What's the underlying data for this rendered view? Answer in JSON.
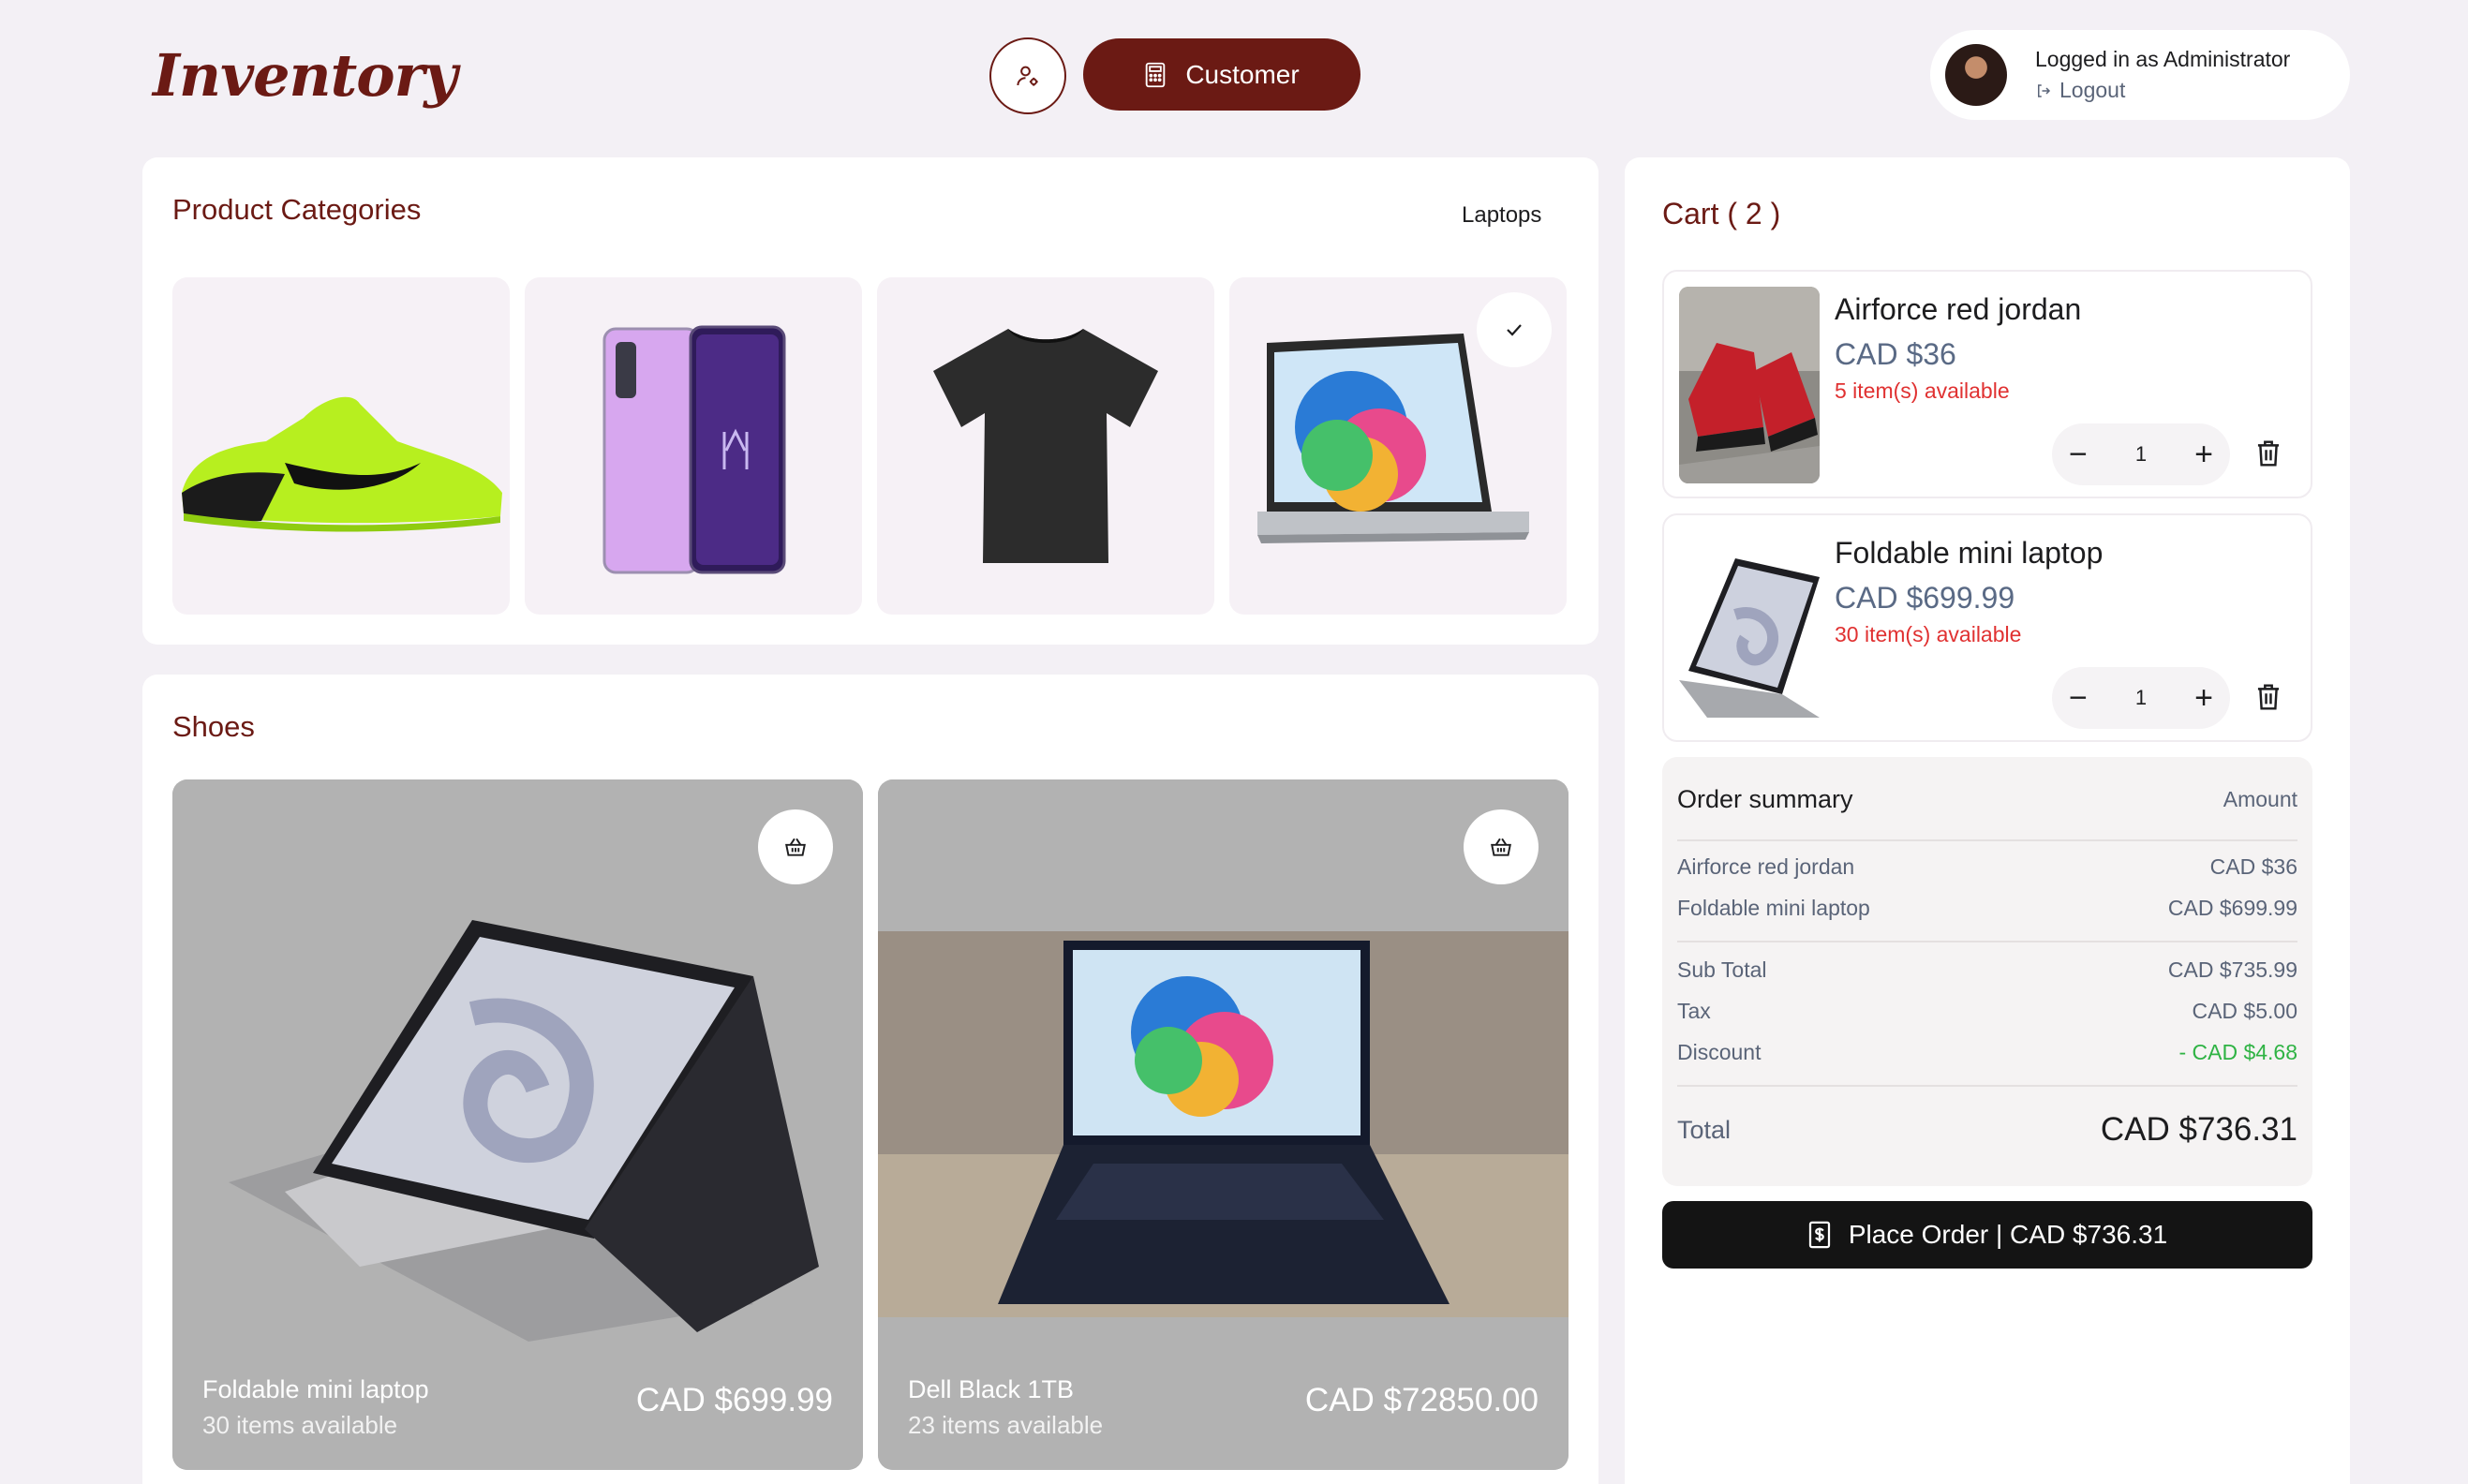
{
  "header": {
    "logo": "Inventory",
    "user_icon": "user-settings-icon",
    "customer_label": "Customer",
    "account_name": "Logged in as Administrator",
    "logout_label": "Logout"
  },
  "categories": {
    "title": "Product Categories",
    "selected": "Laptops",
    "tiles": [
      {
        "name": "shoes",
        "selected": false
      },
      {
        "name": "phones",
        "selected": false
      },
      {
        "name": "t-shirts",
        "selected": false
      },
      {
        "name": "laptops",
        "selected": true
      }
    ]
  },
  "listing": {
    "title": "Shoes",
    "products": [
      {
        "name": "Foldable mini laptop",
        "stock": "30 items available",
        "price": "CAD $699.99"
      },
      {
        "name": "Dell Black 1TB",
        "stock": "23 items available",
        "price": "CAD $72850.00"
      }
    ]
  },
  "cart": {
    "title": "Cart ( 2 )",
    "items": [
      {
        "name": "Airforce red jordan",
        "price": "CAD $36",
        "availability": "5 item(s) available",
        "qty": "1"
      },
      {
        "name": "Foldable mini laptop",
        "price": "CAD $699.99",
        "availability": "30 item(s) available",
        "qty": "1"
      }
    ],
    "summary": {
      "title": "Order summary",
      "amount_label": "Amount",
      "lines": [
        {
          "label": "Airforce red jordan",
          "value": "CAD $36"
        },
        {
          "label": "Foldable mini laptop",
          "value": "CAD $699.99"
        }
      ],
      "subtotal_label": "Sub Total",
      "subtotal": "CAD $735.99",
      "tax_label": "Tax",
      "tax": "CAD $5.00",
      "discount_label": "Discount",
      "discount": "- CAD $4.68",
      "total_label": "Total",
      "total": "CAD $736.31"
    },
    "place_order_label": "Place Order | CAD $736.31"
  },
  "colors": {
    "brand": "#6b1a14",
    "discount": "#2fb344",
    "availability": "#e03131"
  }
}
